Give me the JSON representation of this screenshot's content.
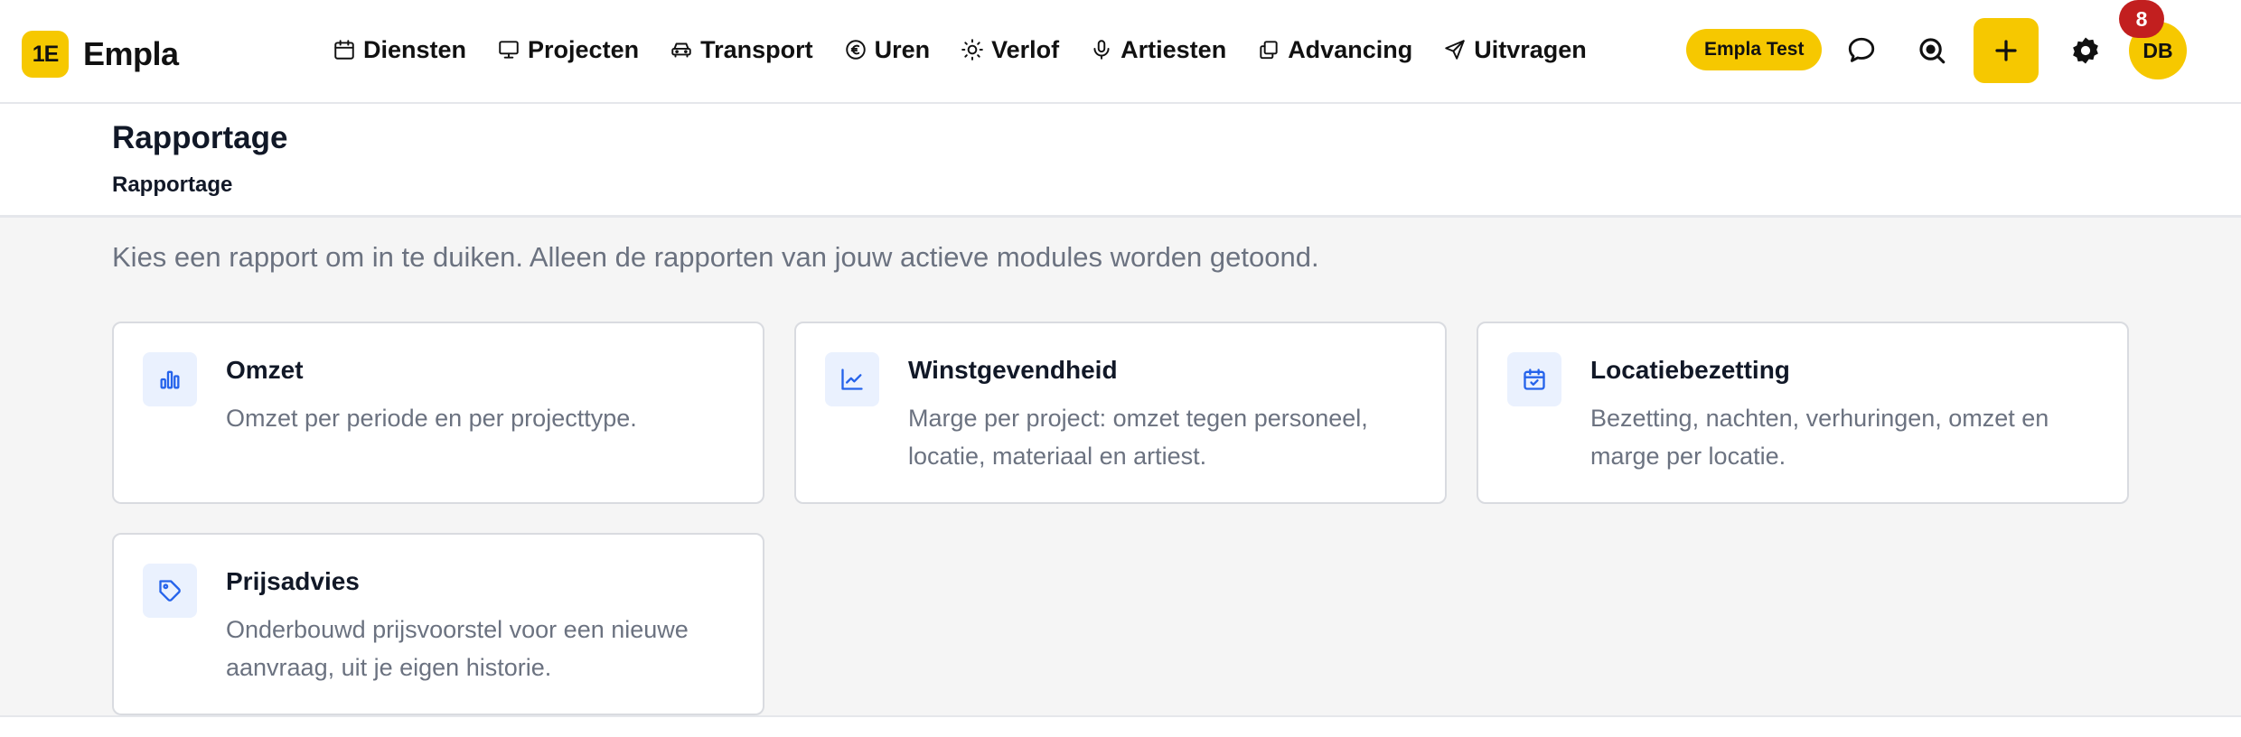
{
  "app": {
    "logo_mark": "1E",
    "name": "Empla"
  },
  "nav": [
    {
      "label": "Diensten",
      "icon": "calendar-icon"
    },
    {
      "label": "Projecten",
      "icon": "monitor-icon"
    },
    {
      "label": "Transport",
      "icon": "car-icon"
    },
    {
      "label": "Uren",
      "icon": "euro-icon"
    },
    {
      "label": "Verlof",
      "icon": "sun-icon"
    },
    {
      "label": "Artiesten",
      "icon": "microphone-icon"
    },
    {
      "label": "Advancing",
      "icon": "copy-icon"
    },
    {
      "label": "Uitvragen",
      "icon": "send-icon"
    }
  ],
  "header_right": {
    "workspace": "Empla Test",
    "avatar_initials": "DB",
    "notification_count": "8"
  },
  "page": {
    "title": "Rapportage",
    "breadcrumb": "Rapportage",
    "intro": "Kies een rapport om in te duiken. Alleen de rapporten van jouw actieve modules worden getoond."
  },
  "reports": [
    {
      "title": "Omzet",
      "description": "Omzet per periode en per projecttype.",
      "icon": "bar-chart-icon"
    },
    {
      "title": "Winstgevendheid",
      "description": "Marge per project: omzet tegen personeel, locatie, materiaal en artiest.",
      "icon": "line-chart-icon"
    },
    {
      "title": "Locatiebezetting",
      "description": "Bezetting, nachten, verhuringen, omzet en marge per locatie.",
      "icon": "calendar-check-icon"
    },
    {
      "title": "Prijsadvies",
      "description": "Onderbouwd prijsvoorstel voor een nieuwe aanvraag, uit je eigen historie.",
      "icon": "tag-icon"
    }
  ],
  "colors": {
    "brand": "#f6c800",
    "accent_blue": "#2563eb",
    "badge_red": "#c21f1f",
    "muted_text": "#6b7280"
  }
}
